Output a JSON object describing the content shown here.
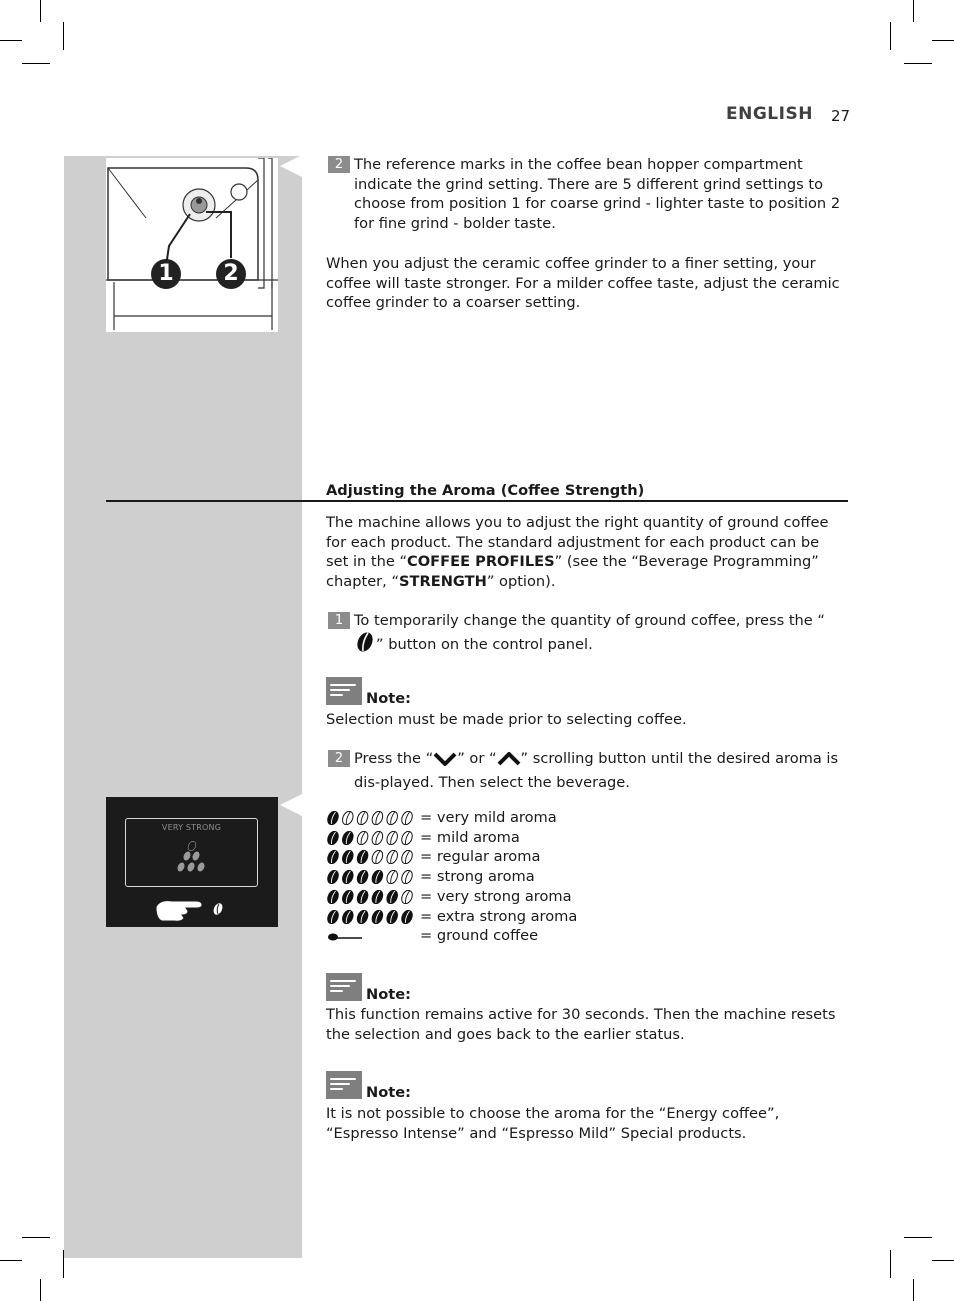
{
  "header": {
    "language": "ENGLISH",
    "page_number": "27"
  },
  "section1": {
    "illustration": {
      "label_1": "1",
      "label_2": "2"
    },
    "step2": {
      "number": "2",
      "text": "The reference marks in the coffee bean hopper compartment indicate the grind setting. There are 5 different grind settings to choose from position 1 for coarse grind - lighter taste to position 2 for fine grind - bolder taste."
    },
    "paragraph": "When you adjust the ceramic coffee grinder to a finer setting, your coffee will taste stronger. For a milder coffee taste, adjust the ceramic coffee grinder to a coarser setting."
  },
  "section2": {
    "heading": "Adjusting the Aroma (Coffee Strength)",
    "intro": {
      "part1": "The machine allows you to adjust the right quantity of ground coffee for each product. The standard adjustment for each product can be set in the “",
      "bold1": "COFFEE PROFILES",
      "part2": "” (see the “Beverage Programming” chapter, “",
      "bold2": "STRENGTH",
      "part3": "” option)."
    },
    "step1": {
      "number": "1",
      "text_before": "To temporarily change the quantity of ground coffee, press the “",
      "icon": "coffee-bean-icon",
      "text_after": "” button on the control panel."
    },
    "note1": {
      "label": "Note:",
      "text": "Selection must be made prior to selecting coffee."
    },
    "step2": {
      "number": "2",
      "text_before": "Press the “",
      "icon_down": "chevron-down-icon",
      "text_mid": "” or “",
      "icon_up": "chevron-up-icon",
      "text_after": "” scrolling button until the desired aroma is dis-played. Then select the beverage."
    },
    "display": {
      "title": "VERY STRONG"
    },
    "aroma_levels": [
      {
        "filled": 1,
        "total": 6,
        "label": "= very mild aroma"
      },
      {
        "filled": 2,
        "total": 6,
        "label": "= mild aroma"
      },
      {
        "filled": 3,
        "total": 6,
        "label": "= regular aroma"
      },
      {
        "filled": 4,
        "total": 6,
        "label": "= strong aroma"
      },
      {
        "filled": 5,
        "total": 6,
        "label": "= very strong aroma"
      },
      {
        "filled": 6,
        "total": 6,
        "label": "= extra strong aroma"
      },
      {
        "filled": 0,
        "total": 0,
        "icon": "scoop-icon",
        "label": "= ground coffee"
      }
    ],
    "note2": {
      "label": "Note:",
      "text": "This function remains active for 30 seconds. Then the machine resets the selection and goes back to the earlier status."
    },
    "note3": {
      "label": "Note:",
      "text": "It is not possible to choose the aroma for the “Energy coffee”, “Espresso Intense” and “Espresso Mild” Special products."
    }
  }
}
